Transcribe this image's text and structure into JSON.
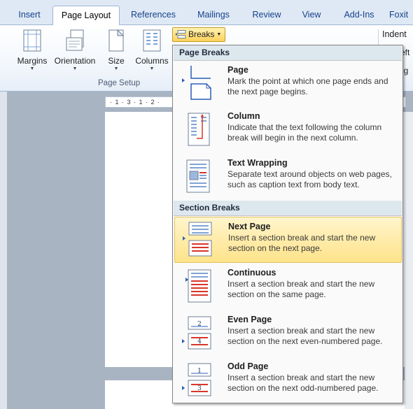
{
  "tabs": [
    "Insert",
    "Page Layout",
    "References",
    "Mailings",
    "Review",
    "View",
    "Add-Ins",
    "Foxit"
  ],
  "active_tab": "Page Layout",
  "ribbon": {
    "margins": "Margins",
    "orientation": "Orientation",
    "size": "Size",
    "columns": "Columns",
    "group_label": "Page Setup",
    "breaks": "Breaks",
    "indent": "Indent",
    "left_partial": "eft",
    "right_partial": "ig"
  },
  "ruler_text": "· 1 · 3 · 1 · 2 ·",
  "menu": {
    "page_breaks_header": "Page Breaks",
    "section_breaks_header": "Section Breaks",
    "items": [
      {
        "title": "Page",
        "desc": "Mark the point at which one page ends and the next page begins."
      },
      {
        "title": "Column",
        "desc": "Indicate that the text following the column break will begin in the next column."
      },
      {
        "title": "Text Wrapping",
        "desc": "Separate text around objects on web pages, such as caption text from body text."
      },
      {
        "title": "Next Page",
        "desc": "Insert a section break and start the new section on the next page."
      },
      {
        "title": "Continuous",
        "desc": "Insert a section break and start the new section on the same page."
      },
      {
        "title": "Even Page",
        "desc": "Insert a section break and start the new section on the next even-numbered page."
      },
      {
        "title": "Odd Page",
        "desc": "Insert a section break and start the new section on the next odd-numbered page."
      }
    ],
    "highlighted_item": "Next Page",
    "even_icon_numbers": [
      "2",
      "4"
    ],
    "odd_icon_numbers": [
      "1",
      "3"
    ]
  },
  "colors": {
    "highlight": "#ffe38a",
    "accent_red": "#d9352a",
    "tab_text": "#15428b"
  }
}
